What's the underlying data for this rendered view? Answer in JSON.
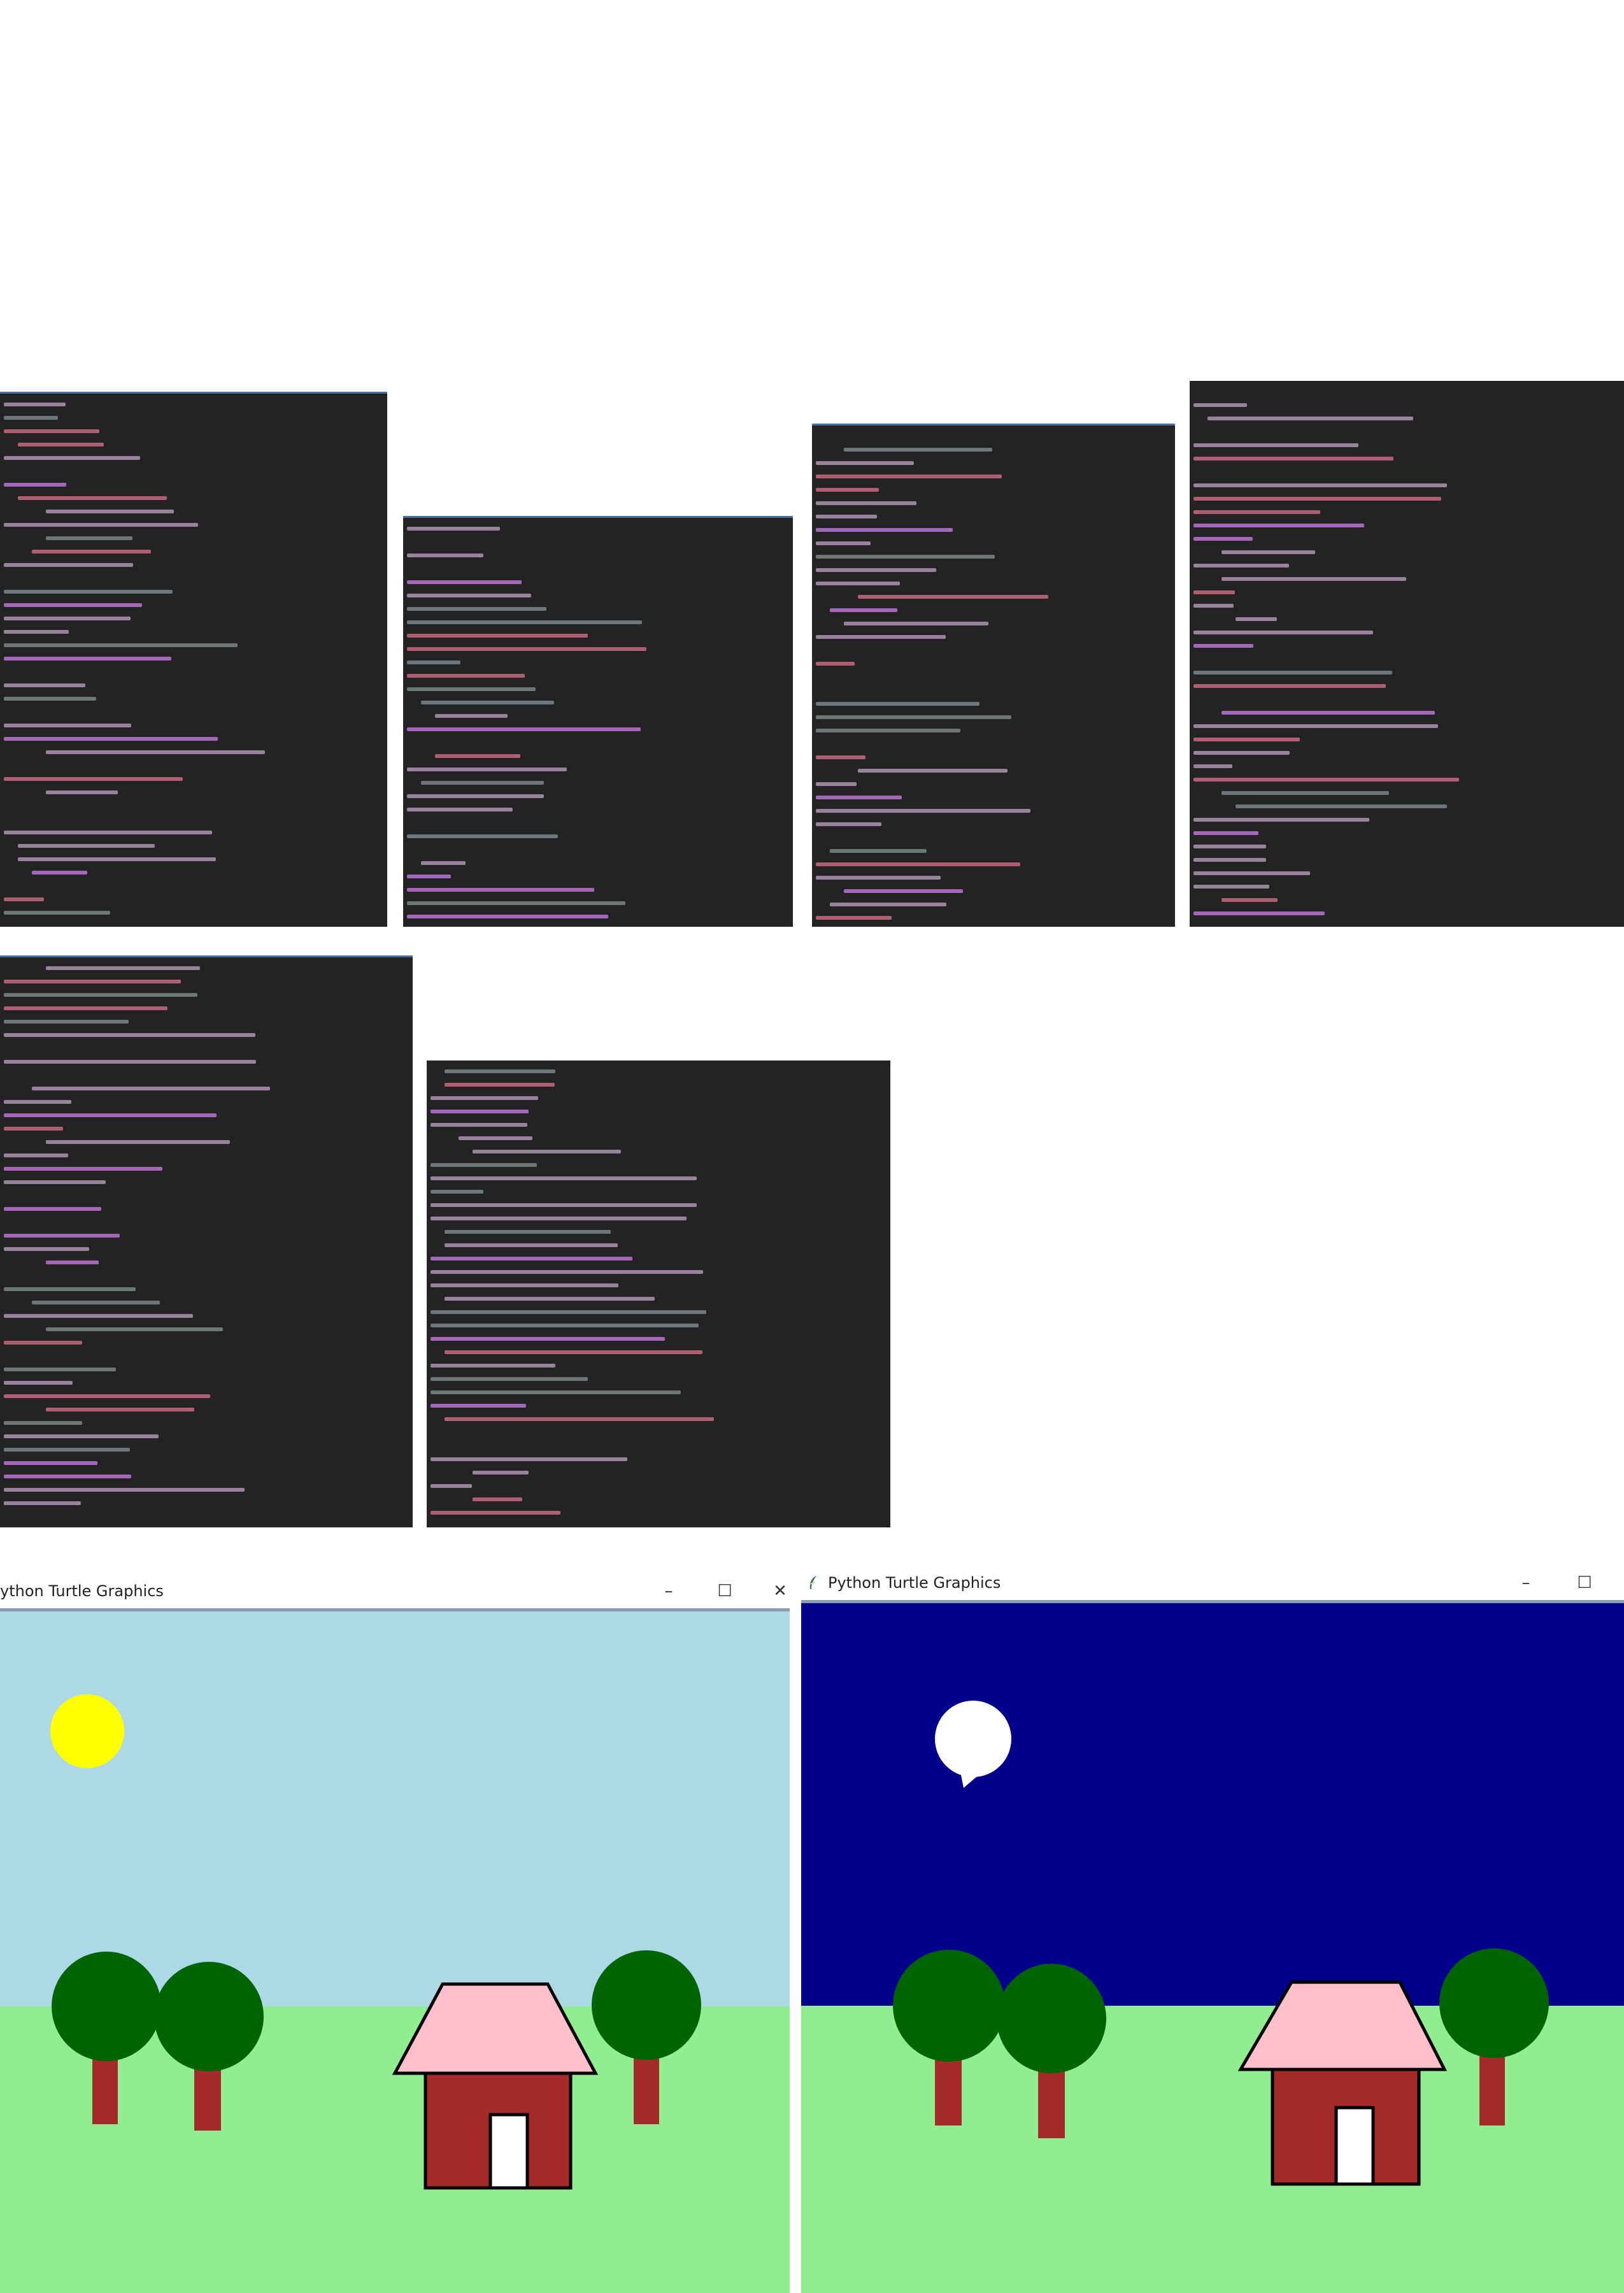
{
  "code_panels": [
    {
      "id": "panel-1",
      "name": "code-panel-1"
    },
    {
      "id": "panel-2",
      "name": "code-panel-2"
    },
    {
      "id": "panel-3",
      "name": "code-panel-3"
    },
    {
      "id": "panel-4",
      "name": "code-panel-4"
    },
    {
      "id": "panel-5",
      "name": "code-panel-5"
    },
    {
      "id": "panel-6",
      "name": "code-panel-6"
    }
  ],
  "windows": {
    "day": {
      "title": "ython Turtle Graphics",
      "minimize": "–",
      "maximize": "☐",
      "close": "✕",
      "sky_color": "#add8e6",
      "grass_color": "#90ee90",
      "sun_color": "#ffff00"
    },
    "night": {
      "title": "Python Turtle Graphics",
      "minimize": "–",
      "maximize": "☐",
      "sky_color": "#00008b",
      "grass_color": "#90ee90",
      "moon_color": "#ffffff"
    }
  },
  "scene": {
    "tree_leaf_color": "#006400",
    "trunk_color": "#a52a2a",
    "roof_color": "#ffc0cb",
    "house_color": "#a52a2a",
    "door_color": "#ffffff",
    "outline_color": "#000000"
  },
  "code_colors": {
    "text": "#b79ab9",
    "keyword": "#c678dd",
    "string": "#d36d8c",
    "comment": "#7f8c8d"
  }
}
